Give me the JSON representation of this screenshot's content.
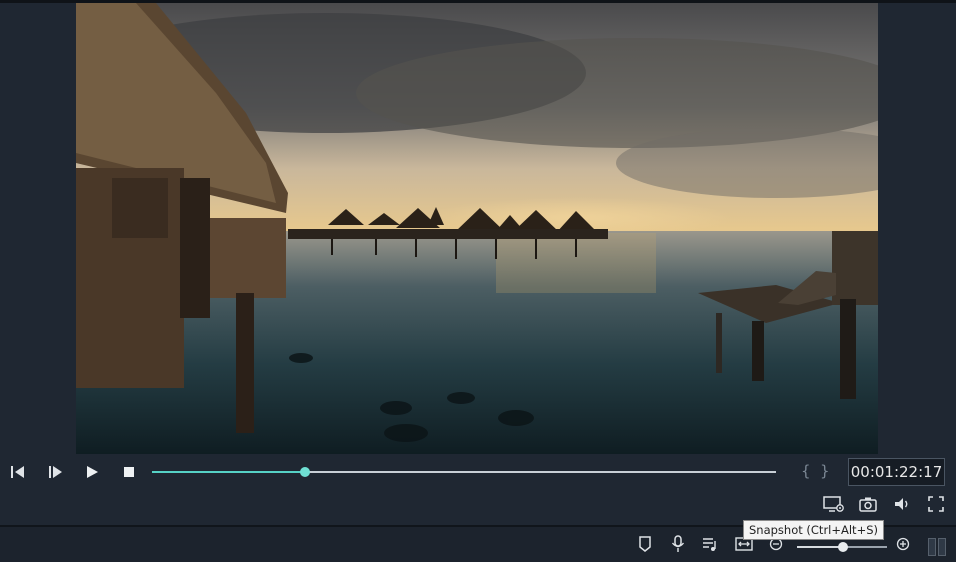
{
  "player": {
    "timecode": "00:01:22:17",
    "progress_fraction": 0.245,
    "in_marker": "{",
    "out_marker": "}"
  },
  "controls": {
    "prev_frame_icon": "step-backward-icon",
    "next_frame_icon": "step-forward-icon",
    "play_icon": "play-icon",
    "stop_icon": "stop-icon"
  },
  "tools": {
    "render_preview_icon": "monitor-settings-icon",
    "snapshot_icon": "camera-icon",
    "volume_icon": "speaker-icon",
    "fullscreen_icon": "fullscreen-icon"
  },
  "tooltip": {
    "text": "Snapshot (Ctrl+Alt+S)"
  },
  "timeline_toolbar": {
    "marker_icon": "marker-icon",
    "voiceover_icon": "microphone-icon",
    "audio_mixer_icon": "audio-list-icon",
    "fit_icon": "fit-timeline-icon",
    "zoom_out_icon": "zoom-out-icon",
    "zoom_in_icon": "zoom-in-icon",
    "zoom_fraction": 0.51
  },
  "colors": {
    "accent": "#56d2c6",
    "background": "#1f2732",
    "timecode_text": "#e8e8e8"
  }
}
